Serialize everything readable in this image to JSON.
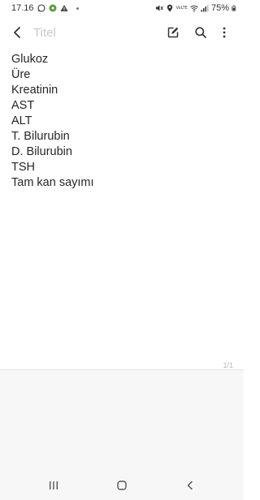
{
  "status_bar": {
    "time": "17.16",
    "battery_percent": "75%",
    "network_label": "VoLTE",
    "left_icons": [
      "whatsapp-icon",
      "app-notification-icon",
      "warning-icon",
      "dot-icon"
    ],
    "right_icons": [
      "mute-icon",
      "location-icon",
      "volte-icon",
      "wifi-icon",
      "signal-icon",
      "battery-icon"
    ]
  },
  "app_bar": {
    "title_placeholder": "Titel",
    "icons": [
      "back-arrow-icon",
      "edit-icon",
      "search-icon",
      "more-vertical-icon"
    ]
  },
  "note": {
    "lines": [
      "Glukoz",
      "Üre",
      "Kreatinin",
      "AST",
      "ALT",
      "T. Bilurubin",
      "D. Bilurubin",
      "TSH",
      "Tam kan sayımı"
    ],
    "page_indicator": "1/1"
  },
  "nav_bar": {
    "icons": [
      "recents-icon",
      "home-icon",
      "back-icon"
    ]
  },
  "colors": {
    "background": "#ffffff",
    "bottom_panel": "#f7f7f7",
    "text": "#262626",
    "placeholder": "#c8c8c8"
  }
}
